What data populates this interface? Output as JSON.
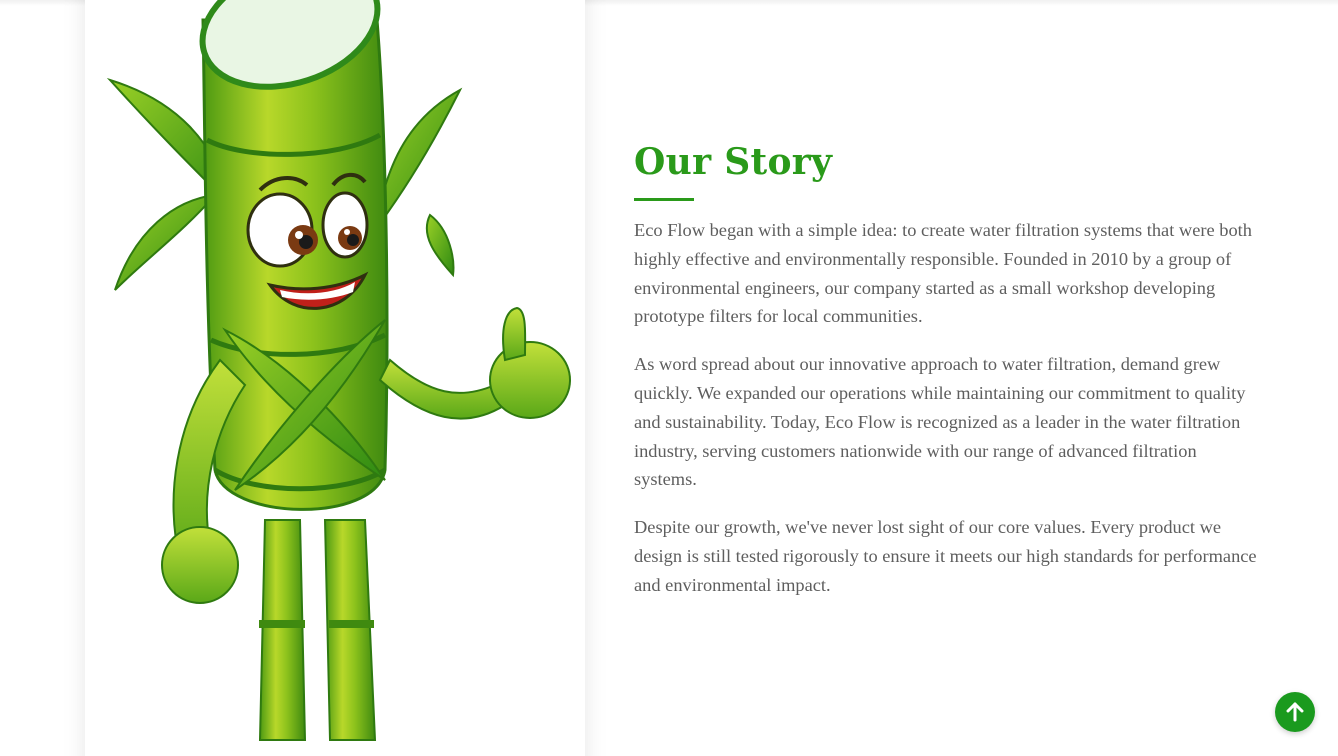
{
  "theme": {
    "accent": "#2a9a1a",
    "button_bg": "#1a9a1e",
    "text_color": "#5e5e5e"
  },
  "hero_image": {
    "icon": "sugarcane-mascot-illustration"
  },
  "story": {
    "title": "Our Story",
    "paragraphs": [
      "Eco Flow began with a simple idea: to create water filtration systems that were both highly effective and environmentally responsible. Founded in 2010 by a group of environmental engineers, our company started as a small workshop developing prototype filters for local communities.",
      "As word spread about our innovative approach to water filtration, demand grew quickly. We expanded our operations while maintaining our commitment to quality and sustainability. Today, Eco Flow is recognized as a leader in the water filtration industry, serving customers nationwide with our range of advanced filtration systems.",
      "Despite our growth, we've never lost sight of our core values. Every product we design is still tested rigorously to ensure it meets our high standards for performance and environmental impact."
    ]
  },
  "back_to_top": {
    "icon": "arrow-up-icon"
  }
}
